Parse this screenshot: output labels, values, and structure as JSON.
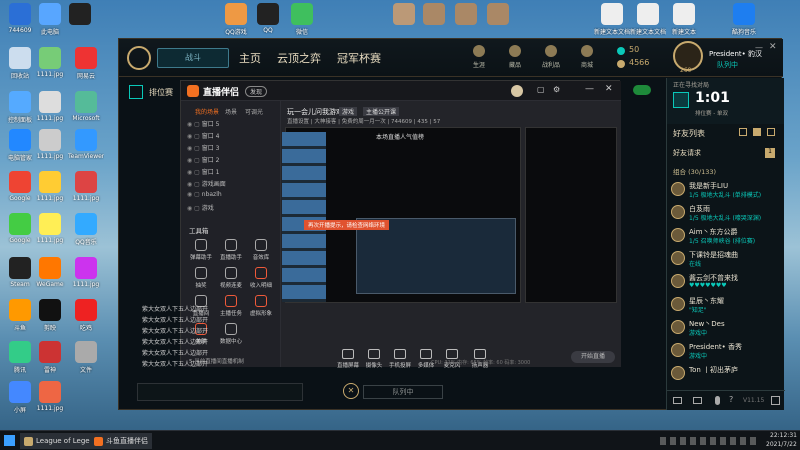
{
  "desktop": {
    "icons": [
      {
        "label": "744609"
      },
      {
        "label": "此电脑"
      },
      {
        "label": ""
      },
      {
        "label": "QQ游戏"
      },
      {
        "label": "QQ"
      },
      {
        "label": "微信"
      },
      {
        "label": ""
      },
      {
        "label": ""
      },
      {
        "label": ""
      },
      {
        "label": ""
      },
      {
        "label": "新建文本文档"
      },
      {
        "label": "新建文本文档"
      },
      {
        "label": "新建文本"
      },
      {
        "label": "酷狗音乐"
      },
      {
        "label": "回收站"
      },
      {
        "label": "1111.jpg"
      },
      {
        "label": "网易云"
      },
      {
        "label": "控制面板"
      },
      {
        "label": "1111.jpg"
      },
      {
        "label": "Microsoft"
      },
      {
        "label": "电脑管家"
      },
      {
        "label": "1111.jpg"
      },
      {
        "label": "TeamViewer"
      },
      {
        "label": "Google"
      },
      {
        "label": "1111.jpg"
      },
      {
        "label": "1111.jpg"
      },
      {
        "label": "Google"
      },
      {
        "label": "1111.jpg"
      },
      {
        "label": "QQ音乐"
      },
      {
        "label": "Steam"
      },
      {
        "label": "WeGame"
      },
      {
        "label": "1111.jpg"
      },
      {
        "label": "斗鱼"
      },
      {
        "label": "剪映"
      },
      {
        "label": "吃鸡"
      },
      {
        "label": "腾讯"
      },
      {
        "label": "雷神"
      },
      {
        "label": "文件"
      },
      {
        "label": "小屏"
      },
      {
        "label": "1111.jpg"
      }
    ]
  },
  "lol": {
    "play_label": "战斗",
    "nav": [
      "主页",
      "云顶之弈",
      "冠军杯赛"
    ],
    "tools": [
      "生涯",
      "藏品",
      "战利品",
      "商城"
    ],
    "currency": {
      "be": "50",
      "rp": "4566"
    },
    "profile": {
      "name": "President• 豹汉",
      "status": "队列中",
      "level": "269"
    },
    "queue": {
      "label": "正在寻找对局",
      "time": "1:01",
      "mode": "排位赛 - 单双"
    },
    "friends_header": "好友列表",
    "friend_requests": "好友请求",
    "request_count": "1",
    "group": "组合 (30/133)",
    "friends": [
      {
        "name": "我是新手LIU",
        "status": "1/5 极地大乱斗 (单排模式)"
      },
      {
        "name": "白芨雨",
        "status": "1/5 极地大乱斗 (嚎哭深渊)"
      },
      {
        "name": "Aim丶东方公爵",
        "status": "1/5 召唤师峡谷 (排位赛)"
      },
      {
        "name": "下课铃是招魂曲",
        "status": "在线"
      },
      {
        "name": "酱云剑不曾来找",
        "status": "♥♥♥♥♥♥♥"
      },
      {
        "name": "星辰丶东耀",
        "status": "\"知足\""
      },
      {
        "name": "New丶Des",
        "status": "游戏中"
      },
      {
        "name": "President• 香秀",
        "status": "游戏中"
      },
      {
        "name": "Ton 丨初出茅庐",
        "status": ""
      }
    ],
    "footer_version": "V11.15",
    "queue_button": "队列中",
    "champ_lobby": "排位赛"
  },
  "stream": {
    "title": "直播伴侣",
    "badge": "发现",
    "tabs": [
      "我的场景",
      "场景",
      "可调光"
    ],
    "room_title": "玩一会儿问我游戏",
    "room_tag1": "游戏",
    "room_tag2": "主播公开课",
    "room_row": "直播设置 | 大神接客 | 免费的周一月一次 | 744609 | 435 | 57",
    "room_id": "744609",
    "viewers": "435",
    "likes": "57",
    "sources": [
      "窗口 5",
      "窗口 4",
      "窗口 3",
      "窗口 2",
      "窗口 1",
      "游戏画面",
      "nbazlh",
      "游戏"
    ],
    "tools_label": "工具箱",
    "tools": [
      "弹幕助手",
      "直播助手",
      "音效库",
      "抽奖",
      "视频连麦",
      "收入明细",
      "直播间",
      "主播任务",
      "虚拟形象",
      "美颜",
      "数据中心"
    ],
    "controls": [
      "直播屏幕",
      "摄像头",
      "手机投屏",
      "多媒体",
      "麦克风",
      "扬声器"
    ],
    "start_button": "开始直播",
    "banner": "本场直播人气值榜",
    "warning": "再次开播提示，请检查网络环境",
    "status_bar": "CPU: 31%  内存: 65%  帧率: 60  码率: 3000",
    "sub_label": "5.当前直播间直播机制",
    "chat": [
      "紫大女双人下五人边部开",
      "紫大女双人下五人边部开",
      "紫大女双人下五人边部开",
      "紫大女双人下五人边部开",
      "紫大女双人下五人边部开",
      "紫大女双人下五人边部开"
    ]
  },
  "taskbar": {
    "items": [
      "League of Legends",
      "斗鱼直播伴侣"
    ],
    "time": "22:12:31",
    "date": "2021/7/22"
  }
}
